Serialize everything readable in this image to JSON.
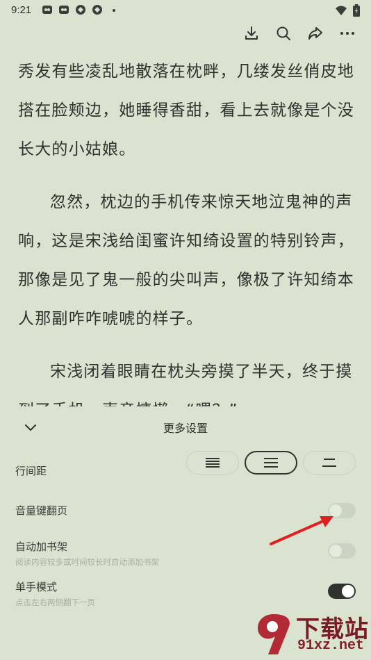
{
  "status": {
    "time": "9:21",
    "icons": [
      "app-notification-icon",
      "app-notification-icon",
      "app-notification-icon",
      "app-notification-icon",
      "dot-icon"
    ],
    "right_icons": [
      "wifi-icon",
      "battery-icon"
    ]
  },
  "toolbar": {
    "icons": [
      "download-icon",
      "search-icon",
      "share-icon",
      "more-icon"
    ]
  },
  "reader": {
    "paragraphs": [
      "秀发有些凌乱地散落在枕畔，几缕发丝俏皮地搭在脸颊边，她睡得香甜，看上去就像是个没长大的小姑娘。",
      "忽然，枕边的手机传来惊天地泣鬼神的声响，这是宋浅给闺蜜许知绮设置的特别铃声，那像是见了鬼一般的尖叫声，像极了许知绮本人那副咋咋唬唬的样子。",
      "宋浅闭着眼睛在枕头旁摸了半天，终于摸到了手机，声音慵懒，“喂？”"
    ]
  },
  "panel": {
    "title": "更多设置",
    "line_spacing": {
      "label": "行间距",
      "options": [
        "dense",
        "normal",
        "loose"
      ],
      "selected": "normal"
    },
    "volume_key_page": {
      "label": "音量键翻页",
      "enabled": false
    },
    "auto_add_shelf": {
      "label": "自动加书架",
      "description": "阅读内容较多或时间较长时自动添加书架",
      "enabled": false
    },
    "one_hand_mode": {
      "label": "单手模式",
      "description": "点击左右两侧翻下一页",
      "enabled": true
    }
  },
  "annotation": {
    "arrow_color": "#e02020"
  },
  "watermark": {
    "text": "下载站",
    "url": "91xz.net"
  },
  "colors": {
    "background": "#d9e3d0",
    "text": "#2f332e",
    "toggle_on": "#2f332e",
    "watermark": "#7a1a24"
  }
}
